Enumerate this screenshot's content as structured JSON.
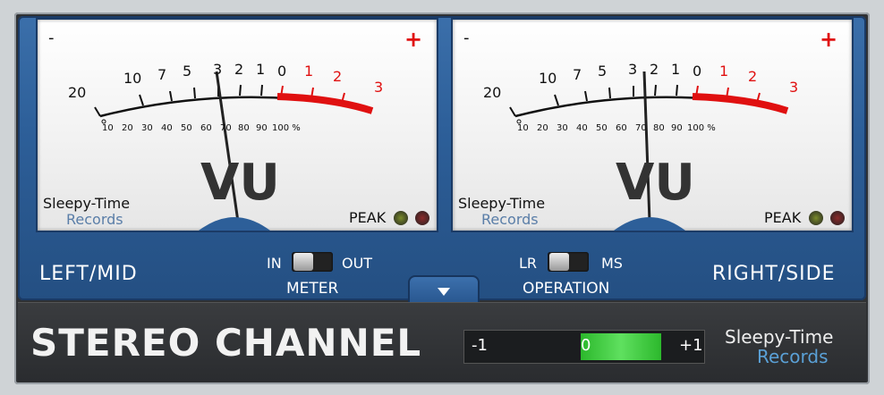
{
  "left_meter": {
    "minus": "-",
    "plus": "+",
    "scale_top": [
      "20",
      "10",
      "7",
      "5",
      "3",
      "2",
      "1",
      "0",
      "1",
      "2",
      "3"
    ],
    "scale_pct": [
      "0",
      "10",
      "20",
      "30",
      "40",
      "50",
      "60",
      "70",
      "80",
      "90",
      "100 %"
    ],
    "vu": "VU",
    "brand_line1": "Sleepy-Time",
    "brand_line2": "Records",
    "peak": "PEAK"
  },
  "right_meter": {
    "minus": "-",
    "plus": "+",
    "scale_top": [
      "20",
      "10",
      "7",
      "5",
      "3",
      "2",
      "1",
      "0",
      "1",
      "2",
      "3"
    ],
    "scale_pct": [
      "0",
      "10",
      "20",
      "30",
      "40",
      "50",
      "60",
      "70",
      "80",
      "90",
      "100 %"
    ],
    "vu": "VU",
    "brand_line1": "Sleepy-Time",
    "brand_line2": "Records",
    "peak": "PEAK"
  },
  "left_label": "LEFT/MID",
  "right_label": "RIGHT/SIDE",
  "meter_toggle": {
    "left": "IN",
    "right": "OUT",
    "caption": "METER"
  },
  "operation_toggle": {
    "left": "LR",
    "right": "MS",
    "caption": "OPERATION"
  },
  "title": "STEREO CHANNEL",
  "balance": {
    "min": "-1",
    "center": "0",
    "max": "+1"
  },
  "brand_bottom": {
    "line1": "Sleepy-Time",
    "line2": "Records"
  },
  "colors": {
    "panel_blue": "#2d5f99",
    "red_zone": "#e01010",
    "meter_green": "#33cc33"
  }
}
